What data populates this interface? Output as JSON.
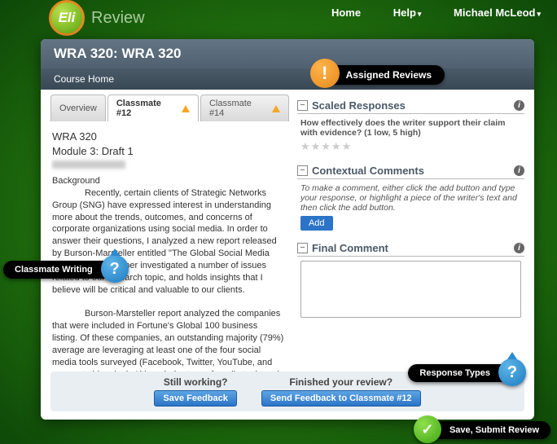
{
  "nav": {
    "home": "Home",
    "help": "Help",
    "user": "Michael McLeod"
  },
  "logo": {
    "badge": "Eli",
    "text": "Review"
  },
  "page": {
    "title": "WRA 320: WRA 320",
    "course_home": "Course Home",
    "assigned_reviews": "Assigned Reviews"
  },
  "tabs": {
    "overview": "Overview",
    "c12": "Classmate #12",
    "c14": "Classmate #14"
  },
  "doc": {
    "course": "WRA 320",
    "module": "Module 3: Draft 1",
    "h_background": "Background",
    "p1_indent": "Recently, certain clients of Strategic Networks Group (SNG) have expressed interest in understanding more about the trends, outcomes, and concerns of corporate organizations using social media. In order to answer their questions, I analyzed a new report released by Burson-Marsteller entitled \"The Global Social Media Checkup.\" This paper investigated a number of issues related to our research topic, and holds insights that I believe will be critical and valuable to our clients.",
    "p2": "Burson-Marsteller report analyzed the companies that were included in Fortune's Global 100 business listing. Of these companies, an outstanding majority (79%) average are leveraging at least one of the four social media tools surveyed (Facebook, Twitter, YouTube, and corporate blogging). Although the type of media tool used varied by geographic location, (Asian-based companies showed higher levels of corporate blogging, whereas U.S. organizations preferred Twitter and Facebook, etc.) the trend towards successful"
  },
  "scaled": {
    "title": "Scaled Responses",
    "prompt": "How effectively does the writer support their claim with evidence? (1 low, 5 high)"
  },
  "contextual": {
    "title": "Contextual Comments",
    "hint": "To make a comment, either click the add button and type your response, or highlight a piece of the writer's text and then click the add button.",
    "add": "Add"
  },
  "final": {
    "title": "Final Comment"
  },
  "footer": {
    "still_q": "Still working?",
    "still_btn": "Save Feedback",
    "done_q": "Finished your review?",
    "done_btn": "Send Feedback to Classmate #12"
  },
  "callouts": {
    "writing": "Classmate Writing",
    "types": "Response Types",
    "submit": "Save, Submit Review"
  }
}
